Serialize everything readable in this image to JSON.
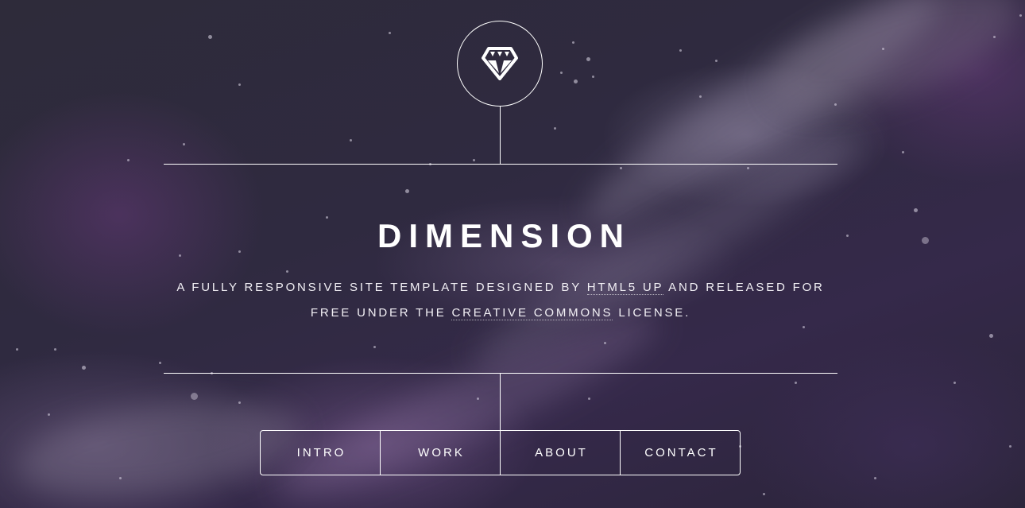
{
  "header": {
    "logo_icon": "diamond-icon",
    "title": "DIMENSION",
    "tagline": {
      "part1": "A FULLY RESPONSIVE SITE TEMPLATE DESIGNED BY ",
      "link1": "HTML5 UP",
      "part2": " AND RELEASED FOR FREE UNDER THE ",
      "link2": "CREATIVE COMMONS",
      "part3": " LICENSE."
    }
  },
  "nav": {
    "items": [
      {
        "label": "INTRO"
      },
      {
        "label": "WORK"
      },
      {
        "label": "ABOUT"
      },
      {
        "label": "CONTACT"
      }
    ]
  },
  "colors": {
    "text": "#ffffff",
    "background": "#2f2a40"
  }
}
